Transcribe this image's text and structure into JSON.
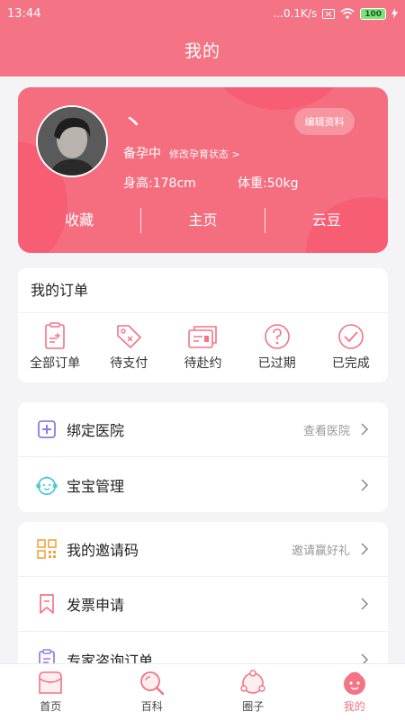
{
  "status_bar": {
    "time": "13:44",
    "network": "...0.1K/s",
    "battery": "100"
  },
  "header": {
    "title": "我的"
  },
  "profile": {
    "nickname": "丶",
    "edit_label": "编辑资料",
    "status": "备孕中",
    "status_link": "修改孕育状态 >",
    "height": "身高:178cm",
    "weight": "体重:50kg",
    "stats": [
      "收藏",
      "主页",
      "云豆"
    ]
  },
  "orders": {
    "title": "我的订单",
    "items": [
      {
        "label": "全部订单",
        "icon": "all-orders-icon"
      },
      {
        "label": "待支付",
        "icon": "price-tag-icon"
      },
      {
        "label": "待赴约",
        "icon": "ticket-icon"
      },
      {
        "label": "已过期",
        "icon": "question-icon"
      },
      {
        "label": "已完成",
        "icon": "check-icon"
      }
    ]
  },
  "list_group_1": [
    {
      "label": "绑定医院",
      "right": "查看医院",
      "icon": "hospital-icon"
    },
    {
      "label": "宝宝管理",
      "right": "",
      "icon": "baby-face-icon"
    }
  ],
  "list_group_2": [
    {
      "label": "我的邀请码",
      "right": "邀请赢好礼",
      "icon": "qr-code-icon"
    },
    {
      "label": "发票申请",
      "right": "",
      "icon": "invoice-bookmark-icon"
    },
    {
      "label": "专家咨询订单",
      "right": "",
      "icon": "clipboard-icon"
    }
  ],
  "tabs": [
    {
      "label": "首页",
      "icon": "home-icon"
    },
    {
      "label": "百科",
      "icon": "search-icon"
    },
    {
      "label": "圈子",
      "icon": "circle-network-icon"
    },
    {
      "label": "我的",
      "icon": "baby-profile-icon"
    }
  ],
  "colors": {
    "primary": "#f47385",
    "card": "#f46e7f",
    "accent_purple": "#8b7de8",
    "accent_teal": "#3fc7d8",
    "accent_orange": "#f5a23c"
  }
}
